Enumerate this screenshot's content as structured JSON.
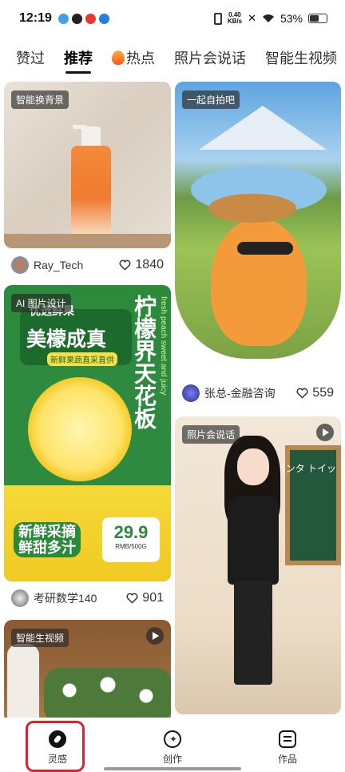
{
  "status_bar": {
    "time": "12:19",
    "net_speed_value": "0.40",
    "net_speed_unit": "KB/s",
    "battery": "53%"
  },
  "tabs": [
    {
      "label": "赞过",
      "active": false
    },
    {
      "label": "推荐",
      "active": true
    },
    {
      "label": "热点",
      "active": false,
      "icon": "fire-icon"
    },
    {
      "label": "照片会说话",
      "active": false
    },
    {
      "label": "智能生视频",
      "active": false
    }
  ],
  "cards": {
    "bottle": {
      "tag": "智能换背景",
      "author": "Ray_Tech",
      "likes": "1840"
    },
    "cat": {
      "tag": "一起自拍吧",
      "author": "张总-金融咨询",
      "likes": "559"
    },
    "lemon": {
      "tag": "AI 图片设计",
      "author": "考研数学140",
      "likes": "901",
      "poster": {
        "sub": "优选鲜果",
        "headline": "美檬成真",
        "sub2": "新鲜果蔬直采直供",
        "title": "柠檬界天花板",
        "english": "fresh peach sweet and juicy",
        "slogan_1": "新鲜采摘",
        "slogan_2": "鲜甜多汁",
        "price": "29.9",
        "price_unit": "RMB/500G"
      }
    },
    "teacher": {
      "tag": "照片会说话",
      "board_text": "ロボンタ トイッ"
    },
    "chef": {
      "tag": "智能生视频"
    }
  },
  "bottom_nav": [
    {
      "label": "灵感",
      "icon": "compass-icon",
      "active": true
    },
    {
      "label": "创作",
      "icon": "sparkle-icon",
      "active": false
    },
    {
      "label": "作品",
      "icon": "list-icon",
      "active": false
    }
  ],
  "colors": {
    "highlight": "#e0222c",
    "accent_dark": "#111111"
  }
}
